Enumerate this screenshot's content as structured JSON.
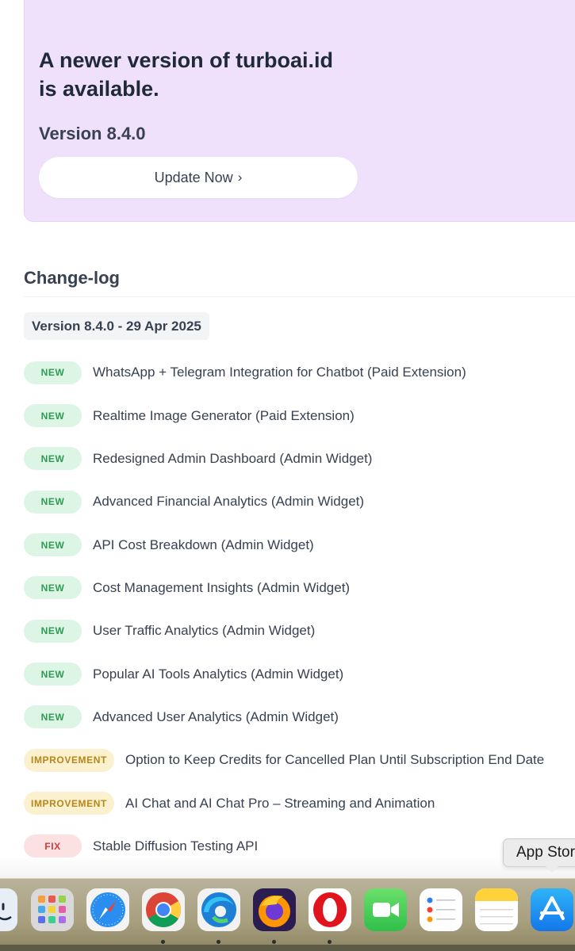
{
  "update_banner": {
    "title": "A newer version of turboai.id is available.",
    "version": "Version 8.4.0",
    "button_label": "Update Now",
    "button_chevron": "›",
    "background": "#efe0fb"
  },
  "changelog": {
    "heading": "Change-log",
    "version_label": "Version 8.4.0 - 29 Apr 2025",
    "entries": [
      {
        "type": "new",
        "badge": "NEW",
        "text": "WhatsApp + Telegram Integration for Chatbot (Paid Extension)"
      },
      {
        "type": "new",
        "badge": "NEW",
        "text": "Realtime Image Generator (Paid Extension)"
      },
      {
        "type": "new",
        "badge": "NEW",
        "text": "Redesigned Admin Dashboard (Admin Widget)"
      },
      {
        "type": "new",
        "badge": "NEW",
        "text": "Advanced Financial Analytics (Admin Widget)"
      },
      {
        "type": "new",
        "badge": "NEW",
        "text": "API Cost Breakdown (Admin Widget)"
      },
      {
        "type": "new",
        "badge": "NEW",
        "text": "Cost Management Insights (Admin Widget)"
      },
      {
        "type": "new",
        "badge": "NEW",
        "text": "User Traffic Analytics (Admin Widget)"
      },
      {
        "type": "new",
        "badge": "NEW",
        "text": "Popular AI Tools Analytics (Admin Widget)"
      },
      {
        "type": "new",
        "badge": "NEW",
        "text": "Advanced User Analytics (Admin Widget)"
      },
      {
        "type": "improvement",
        "badge": "IMPROVEMENT",
        "text": "Option to Keep Credits for Cancelled Plan Until Subscription End Date"
      },
      {
        "type": "improvement",
        "badge": "IMPROVEMENT",
        "text": "AI Chat and AI Chat Pro – Streaming and Animation"
      },
      {
        "type": "fix",
        "badge": "FIX",
        "text": "Stable Diffusion Testing API"
      }
    ],
    "badge_colors": {
      "new": "#2f9a55",
      "improvement": "#b7861a",
      "fix": "#d23a3c"
    }
  },
  "tooltip": {
    "text": "App Store"
  },
  "dock": {
    "apps": [
      {
        "name": "finder-icon",
        "running": false
      },
      {
        "name": "launchpad-icon",
        "running": false
      },
      {
        "name": "safari-icon",
        "running": false
      },
      {
        "name": "chrome-icon",
        "running": true
      },
      {
        "name": "edge-icon",
        "running": true
      },
      {
        "name": "firefox-icon",
        "running": true
      },
      {
        "name": "opera-icon",
        "running": true
      },
      {
        "name": "facetime-icon",
        "running": false
      },
      {
        "name": "reminders-icon",
        "running": false
      },
      {
        "name": "notes-icon",
        "running": false
      },
      {
        "name": "app-store-icon",
        "running": false
      }
    ]
  }
}
